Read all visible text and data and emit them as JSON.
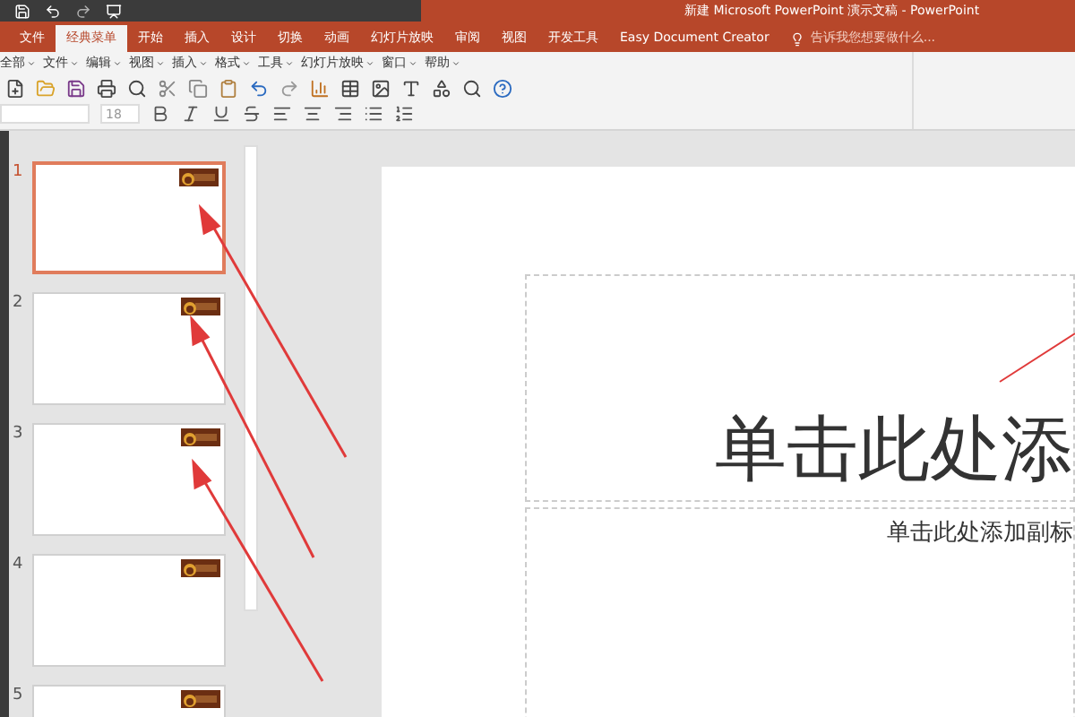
{
  "window": {
    "title": "新建 Microsoft PowerPoint 演示文稿 - PowerPoint"
  },
  "tabs": [
    {
      "label": "文件",
      "selected": false
    },
    {
      "label": "经典菜单",
      "selected": true
    },
    {
      "label": "开始",
      "selected": false
    },
    {
      "label": "插入",
      "selected": false
    },
    {
      "label": "设计",
      "selected": false
    },
    {
      "label": "切换",
      "selected": false
    },
    {
      "label": "动画",
      "selected": false
    },
    {
      "label": "幻灯片放映",
      "selected": false
    },
    {
      "label": "审阅",
      "selected": false
    },
    {
      "label": "视图",
      "selected": false
    },
    {
      "label": "开发工具",
      "selected": false
    },
    {
      "label": "Easy Document Creator",
      "selected": false
    }
  ],
  "tell_me": {
    "placeholder": "告诉我您想要做什么..."
  },
  "menu": [
    "全部",
    "文件",
    "编辑",
    "视图",
    "插入",
    "格式",
    "工具",
    "幻灯片放映",
    "窗口",
    "帮助"
  ],
  "font_size": "18",
  "slides": [
    {
      "number": "1",
      "selected": true
    },
    {
      "number": "2",
      "selected": false
    },
    {
      "number": "3",
      "selected": false
    },
    {
      "number": "4",
      "selected": false
    },
    {
      "number": "5",
      "selected": false
    }
  ],
  "slide": {
    "title_placeholder": "单击此处添",
    "subtitle_placeholder": "单击此处添加副标"
  }
}
